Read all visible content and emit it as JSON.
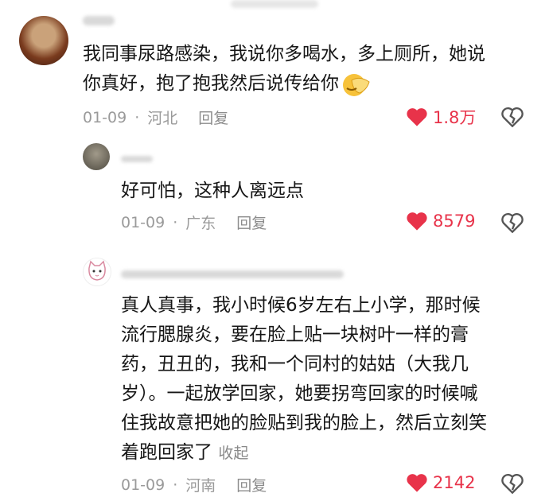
{
  "comments": [
    {
      "text_line1": "我同事尿路感染，我说你多喝水，多上厕所，她说",
      "text_line2": "你真好，抱了抱我然后说传给你",
      "date": "01-09",
      "sep": "·",
      "location": "河北",
      "reply": "回复",
      "likes": "1.8万"
    }
  ],
  "replies": [
    {
      "text": "好可怕，这种人离远点",
      "date": "01-09",
      "sep": "·",
      "location": "广东",
      "reply": "回复",
      "likes": "8579"
    },
    {
      "lines": [
        "真人真事，我小时候6岁左右上小学，那时候",
        "流行腮腺炎，要在脸上贴一块树叶一样的膏",
        "药，丑丑的，我和一个同村的姑姑（大我几",
        "岁）。一起放学回家，她要拐弯回家的时候喊",
        "住我故意把她的脸贴到我的脸上，然后立刻笑",
        "着跑回家了"
      ],
      "collapse": "收起",
      "date": "01-09",
      "sep": "·",
      "location": "河南",
      "reply": "回复",
      "likes": "2142"
    }
  ],
  "colors": {
    "like": "#e8334a",
    "meta": "#9a9a9a"
  }
}
